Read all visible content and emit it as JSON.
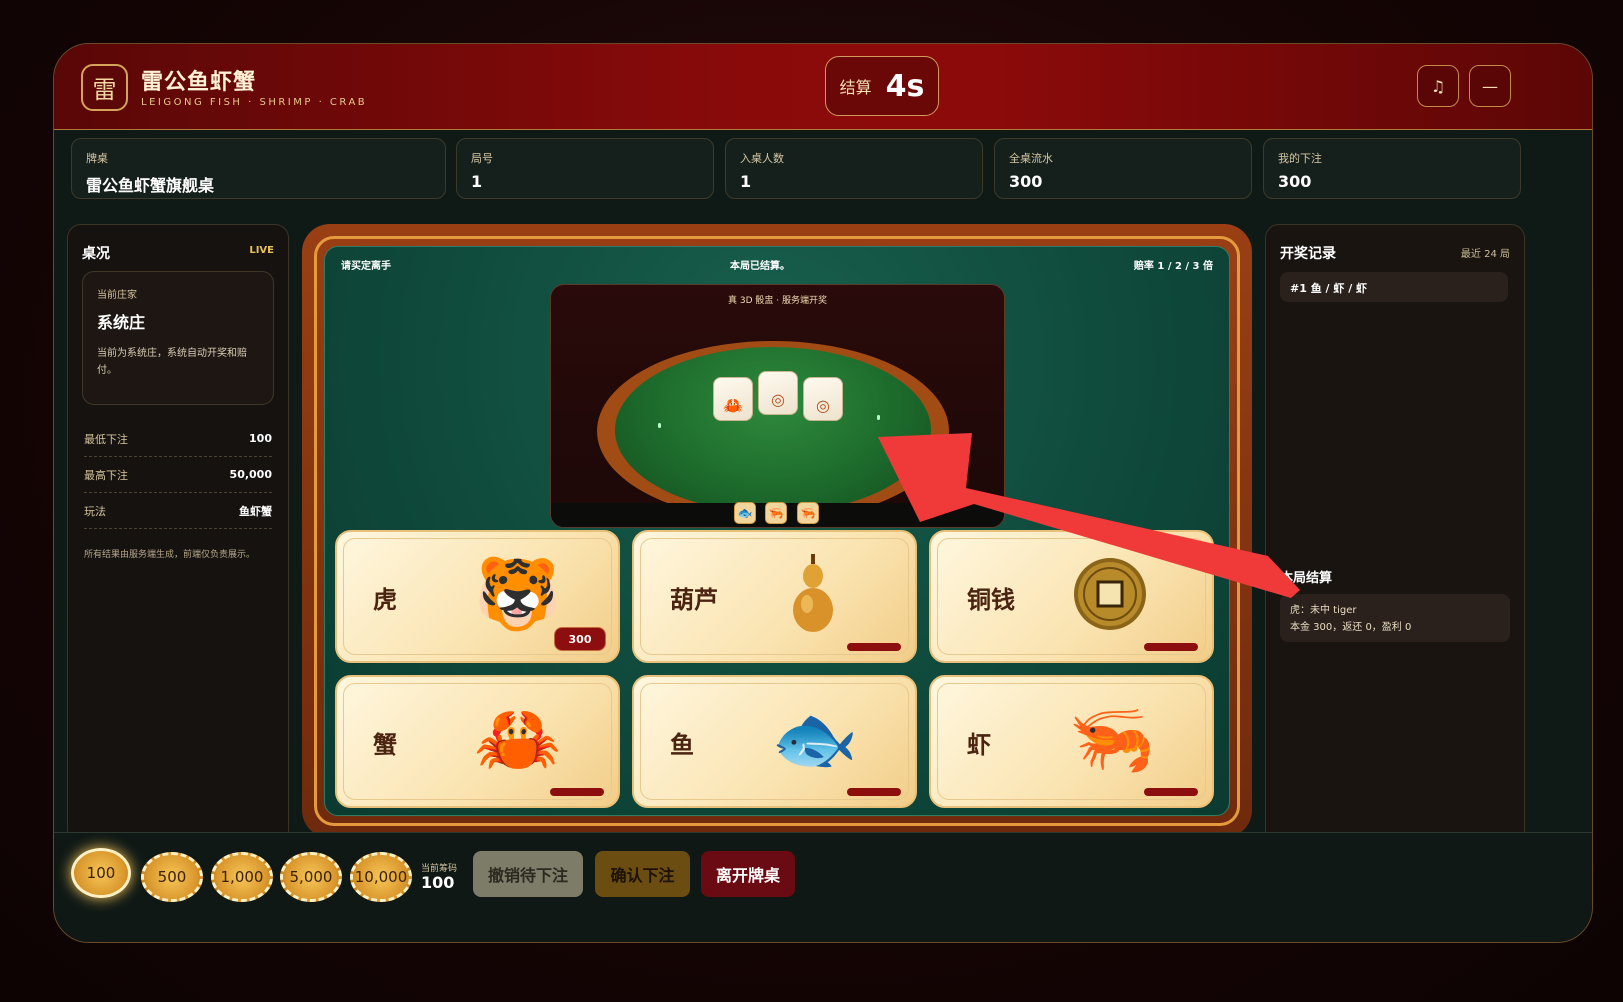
{
  "header": {
    "logo_char": "雷",
    "title": "雷公鱼虾蟹",
    "subtitle": "LEIGONG FISH · SHRIMP · CRAB",
    "timer_label": "结算",
    "timer_value": "4s",
    "music_icon": "♫",
    "minimize_icon": "—"
  },
  "stats": [
    {
      "label": "牌桌",
      "value": "雷公鱼虾蟹旗舰桌"
    },
    {
      "label": "局号",
      "value": "1"
    },
    {
      "label": "入桌人数",
      "value": "1"
    },
    {
      "label": "全桌流水",
      "value": "300"
    },
    {
      "label": "我的下注",
      "value": "300"
    }
  ],
  "left_panel": {
    "title": "桌况",
    "live": "LIVE",
    "dealer_label": "当前庄家",
    "dealer_name": "系统庄",
    "dealer_desc": "当前为系统庄，系统自动开奖和赔付。",
    "rules": [
      {
        "label": "最低下注",
        "value": "100"
      },
      {
        "label": "最高下注",
        "value": "50,000"
      },
      {
        "label": "玩法",
        "value": "鱼虾蟹"
      }
    ],
    "note": "所有结果由服务端生成，前端仅负责展示。"
  },
  "table": {
    "left_label": "请买定离手",
    "center_label": "本局已结算。",
    "right_label": "赔率 1 / 2 / 3 倍",
    "dice_caption": "真 3D 骰盅 · 服务端开奖",
    "dice_faces": [
      "🦀",
      "◎",
      "◎"
    ],
    "result_icons": [
      "🐟",
      "🦐",
      "🦐"
    ],
    "cards": [
      {
        "name": "虎",
        "art": "🐯",
        "bet": "300"
      },
      {
        "name": "葫芦",
        "art": "gourd"
      },
      {
        "name": "铜钱",
        "art": "coin"
      },
      {
        "name": "蟹",
        "art": "🦀"
      },
      {
        "name": "鱼",
        "art": "🐟"
      },
      {
        "name": "虾",
        "art": "🦐"
      }
    ]
  },
  "right_panel": {
    "title": "开奖记录",
    "recent": "最近 24 局",
    "history": [
      "#1 鱼 / 虾 / 虾"
    ],
    "settle_title": "本局结算",
    "settle_line1": "虎：未中 tiger",
    "settle_line2": "本金 300，返还 0，盈利 0"
  },
  "bottom": {
    "chips": [
      "100",
      "500",
      "1,000",
      "5,000",
      "10,000"
    ],
    "selected_chip": "100",
    "current_label": "当前筹码",
    "current_value": "100",
    "cancel_label": "撤销待下注",
    "confirm_label": "确认下注",
    "leave_label": "离开牌桌"
  },
  "colors": {
    "header_red": "#8a0a0a",
    "felt_green": "#0f4a3c",
    "card_gold": "#fae3b0",
    "bar_red": "#8d0e0e",
    "arrow_red": "#f03a3a"
  }
}
